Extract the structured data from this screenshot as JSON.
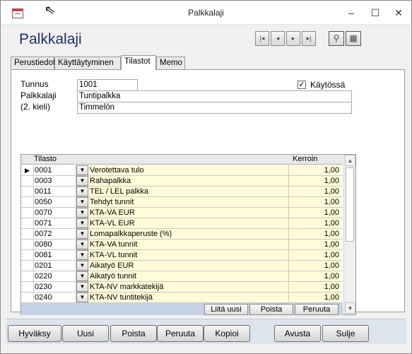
{
  "window": {
    "title": "Palkkalaji"
  },
  "form": {
    "title": "Palkkalaji"
  },
  "nav": {
    "first": "|◂",
    "prev": "◂",
    "next": "▸",
    "last": "▸|"
  },
  "tabs": [
    "Perustiedot",
    "Käyttäytyminen",
    "Tilastot",
    "Memo"
  ],
  "active_tab": "Tilastot",
  "fields": {
    "tunnus_label": "Tunnus",
    "tunnus_value": "1001",
    "palkkalaji_label": "Palkkalaji",
    "palkkalaji_value": "Tuntipalkka",
    "kieli_label": "(2. kieli)",
    "kieli_value": "Timmelön",
    "kaytossa_label": "Käytössä",
    "kaytossa_checked": "✓"
  },
  "grid": {
    "headers": {
      "tilasto": "Tilasto",
      "kerroin": "Kerroin"
    },
    "rows": [
      {
        "code": "0001",
        "name": "Verotettava tulo",
        "value": "1,00"
      },
      {
        "code": "0003",
        "name": "Rahapalkka",
        "value": "1,00"
      },
      {
        "code": "0011",
        "name": "TEL / LEL palkka",
        "value": "1,00"
      },
      {
        "code": "0050",
        "name": "Tehdyt tunnit",
        "value": "1,00"
      },
      {
        "code": "0070",
        "name": "KTA-VA  EUR",
        "value": "1,00"
      },
      {
        "code": "0071",
        "name": "KTA-VL  EUR",
        "value": "1,00"
      },
      {
        "code": "0072",
        "name": "Lomapalkkaperuste (%)",
        "value": "1,00"
      },
      {
        "code": "0080",
        "name": "KTA-VA tunnit",
        "value": "1,00"
      },
      {
        "code": "0081",
        "name": "KTA-VL tunnit",
        "value": "1,00"
      },
      {
        "code": "0201",
        "name": "Aikatyö  EUR",
        "value": "1,00"
      },
      {
        "code": "0220",
        "name": "Aikatyö tunnit",
        "value": "1,00"
      },
      {
        "code": "0230",
        "name": "KTA-NV markkatekijä",
        "value": "1,00"
      },
      {
        "code": "0240",
        "name": "KTA-NV tuntitekijä",
        "value": "1,00"
      }
    ],
    "buttons": {
      "liita_uusi": "Liitä uusi",
      "poista": "Poista",
      "peruuta": "Peruuta"
    }
  },
  "bottom_buttons": {
    "hyvaksy": "Hyväksy",
    "uusi": "Uusi",
    "poista": "Poista",
    "peruuta": "Peruuta",
    "kopioi": "Kopioi",
    "avusta": "Avusta",
    "sulje": "Sulje"
  }
}
